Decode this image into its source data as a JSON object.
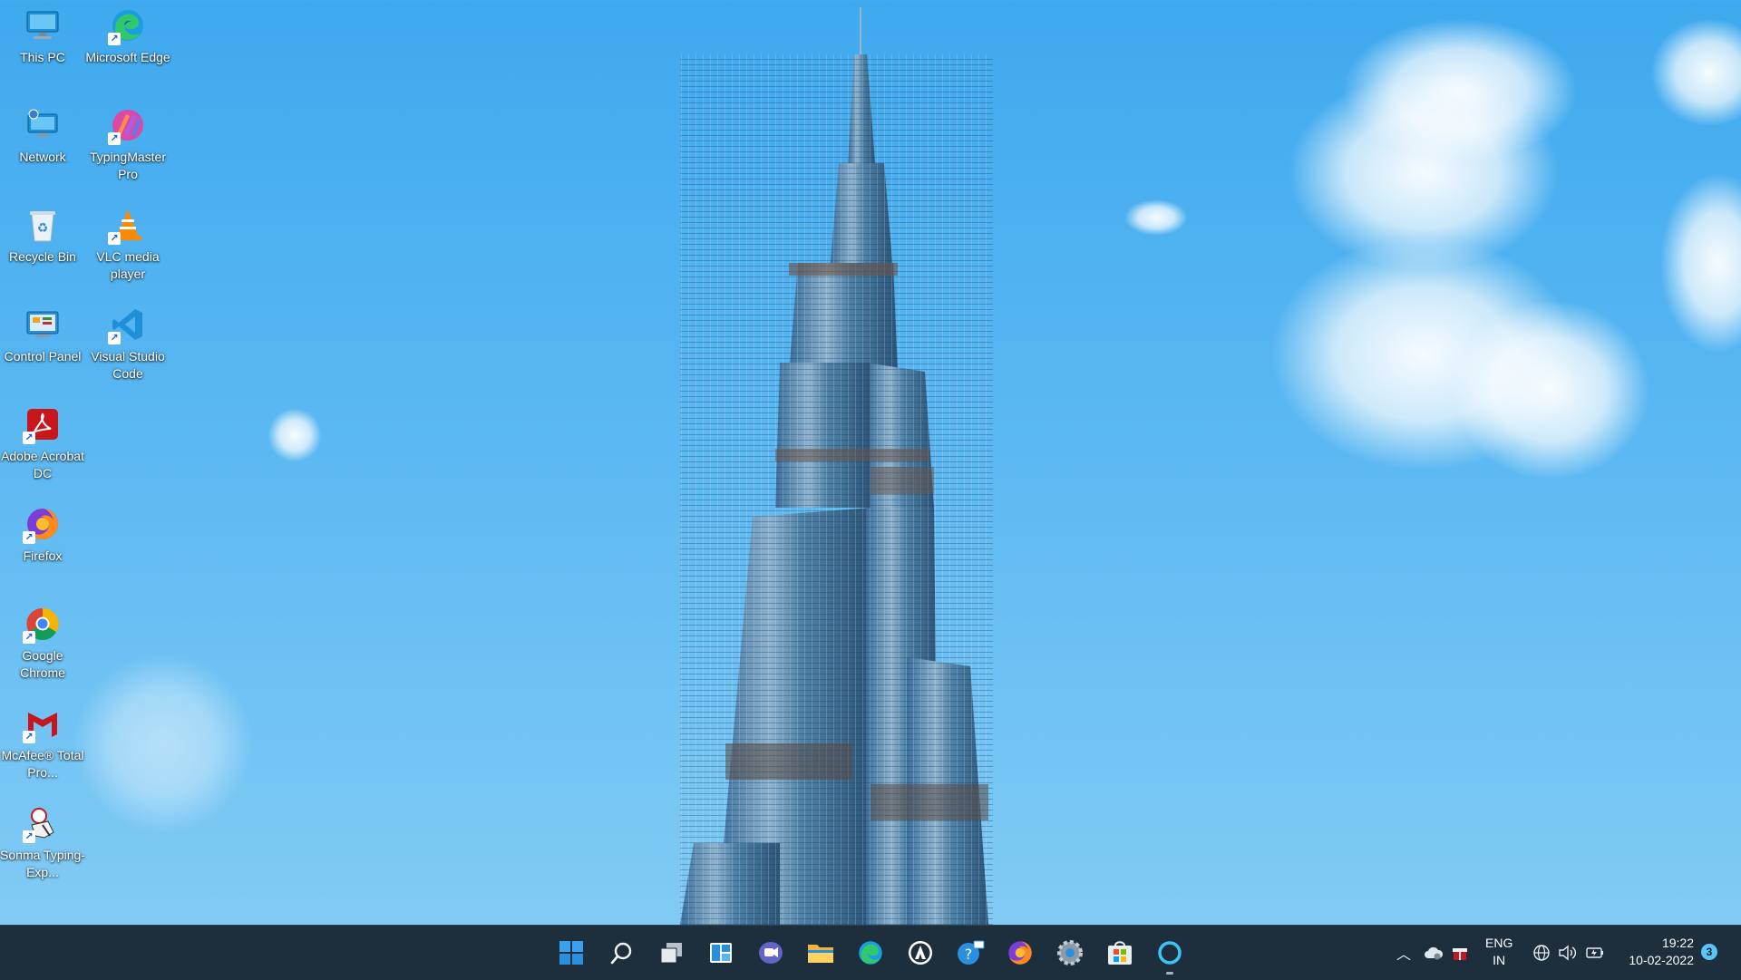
{
  "desktop": {
    "wallpaper_description_colors": {
      "sky_top": "#3fa9ee",
      "sky_bottom": "#86cdf5"
    },
    "icons": [
      {
        "label": "This PC",
        "icon": "computer-icon"
      },
      {
        "label": "Microsoft Edge",
        "icon": "edge-icon",
        "shortcut": true
      },
      {
        "label": "Network",
        "icon": "network-icon"
      },
      {
        "label": "TypingMaster Pro",
        "icon": "typingmaster-icon",
        "shortcut": true
      },
      {
        "label": "Recycle Bin",
        "icon": "recycle-bin-icon"
      },
      {
        "label": "VLC media player",
        "icon": "vlc-icon",
        "shortcut": true
      },
      {
        "label": "Control Panel",
        "icon": "control-panel-icon"
      },
      {
        "label": "Visual Studio Code",
        "icon": "vscode-icon",
        "shortcut": true
      },
      {
        "label": "Adobe Acrobat DC",
        "icon": "acrobat-icon",
        "shortcut": true
      },
      {
        "label": "Firefox",
        "icon": "firefox-icon",
        "shortcut": true
      },
      {
        "label": "Google Chrome",
        "icon": "chrome-icon",
        "shortcut": true
      },
      {
        "label": "McAfee® Total Pro...",
        "icon": "mcafee-icon",
        "shortcut": true
      },
      {
        "label": "Sonma Typing-Exp...",
        "icon": "sonma-icon",
        "shortcut": true
      }
    ]
  },
  "taskbar": {
    "apps": [
      {
        "name": "start",
        "icon": "windows-logo-icon"
      },
      {
        "name": "search",
        "icon": "search-icon"
      },
      {
        "name": "task-view",
        "icon": "task-view-icon"
      },
      {
        "name": "widgets",
        "icon": "widgets-icon"
      },
      {
        "name": "chat",
        "icon": "teams-chat-icon"
      },
      {
        "name": "file-explorer",
        "icon": "folder-icon"
      },
      {
        "name": "edge",
        "icon": "edge-icon"
      },
      {
        "name": "app-unknown",
        "icon": "shield-app-icon"
      },
      {
        "name": "mail",
        "icon": "mail-icon"
      },
      {
        "name": "firefox",
        "icon": "firefox-icon"
      },
      {
        "name": "settings",
        "icon": "gear-icon"
      },
      {
        "name": "store",
        "icon": "store-icon"
      },
      {
        "name": "cortana",
        "icon": "cortana-icon",
        "active": true
      }
    ],
    "tray": {
      "language_line1": "ENG",
      "language_line2": "IN",
      "time": "19:22",
      "date": "10-02-2022",
      "notification_count": "3"
    }
  }
}
